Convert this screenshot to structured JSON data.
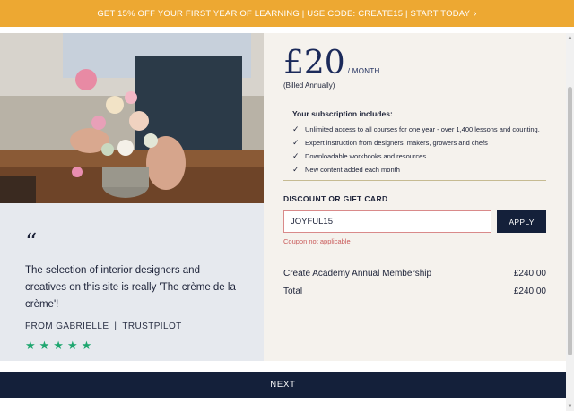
{
  "promo": {
    "text": "GET 15% OFF YOUR FIRST YEAR OF LEARNING | USE CODE: CREATE15 | START TODAY",
    "icon": "chevron-right-icon"
  },
  "testimonial": {
    "quote": "The selection of interior designers and creatives on this site is really 'The crème de la crème'!",
    "author": "FROM GABRIELLE",
    "separator": "|",
    "source": "TRUSTPILOT",
    "stars": "★★★★★",
    "rating": 5,
    "star_color": "#1ea66f"
  },
  "plan": {
    "price": "£20",
    "period": "/ MONTH",
    "billing": "(Billed Annually)"
  },
  "includes": {
    "title": "Your subscription includes:",
    "items": [
      "Unlimited access to all courses for one year - over 1,400 lessons and counting.",
      "Expert instruction from designers, makers, growers and chefs",
      "Downloadable workbooks and resources",
      "New content added each month"
    ]
  },
  "discount": {
    "title": "DISCOUNT OR GIFT CARD",
    "code_value": "JOYFUL15",
    "apply_label": "APPLY",
    "error": "Coupon not applicable"
  },
  "summary": {
    "rows": [
      {
        "label": "Create Academy Annual Membership",
        "amount": "£240.00"
      },
      {
        "label": "Total",
        "amount": "£240.00"
      }
    ]
  },
  "footer": {
    "next_label": "NEXT"
  },
  "colors": {
    "promo_bg": "#eda832",
    "navy": "#14203a",
    "panel_bg": "#f5f2ed",
    "testimonial_bg": "#e6e9ee",
    "error": "#c95a5a"
  }
}
